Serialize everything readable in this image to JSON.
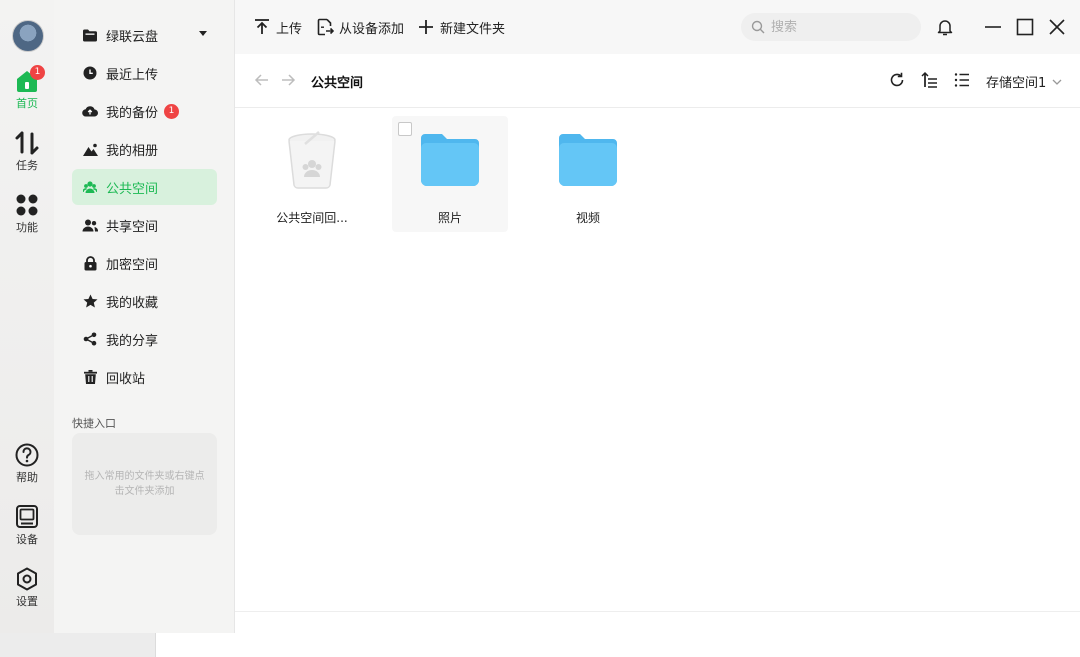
{
  "window": {
    "minimize": "minimize",
    "maximize": "maximize",
    "close": "close"
  },
  "rail": {
    "items": [
      {
        "label": "首页",
        "badge": "1"
      },
      {
        "label": "任务"
      },
      {
        "label": "功能"
      },
      {
        "label": "帮助"
      },
      {
        "label": "设备"
      },
      {
        "label": "设置"
      }
    ]
  },
  "sidebar": {
    "items": [
      {
        "label": "绿联云盘"
      },
      {
        "label": "最近上传"
      },
      {
        "label": "我的备份",
        "badge": "1"
      },
      {
        "label": "我的相册"
      },
      {
        "label": "公共空间"
      },
      {
        "label": "共享空间"
      },
      {
        "label": "加密空间"
      },
      {
        "label": "我的收藏"
      },
      {
        "label": "我的分享"
      },
      {
        "label": "回收站"
      }
    ],
    "quick_title": "快捷入口",
    "quick_hint": "拖入常用的文件夹或右键点击文件夹添加"
  },
  "toolbar": {
    "upload": "上传",
    "add_from_device": "从设备添加",
    "new_folder": "新建文件夹",
    "search_placeholder": "搜索"
  },
  "path": {
    "current": "公共空间",
    "storage": "存储空间1"
  },
  "files": [
    {
      "name": "公共空间回...",
      "kind": "recycle-bin"
    },
    {
      "name": "照片",
      "kind": "folder"
    },
    {
      "name": "视频",
      "kind": "folder"
    }
  ],
  "colors": {
    "accent": "#1db954",
    "active_bg": "#d8f1dd",
    "badge": "#ef4444",
    "folder": "#5ec3f5"
  }
}
